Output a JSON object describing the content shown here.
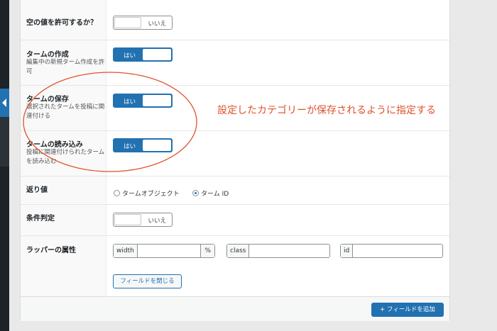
{
  "rows": {
    "allow_null": {
      "label": "空の値を許可するか？",
      "toggle": "いいえ"
    },
    "create_terms": {
      "label": "タームの作成",
      "desc": "編集中の新規ターム作成を許可",
      "toggle": "はい"
    },
    "save_terms": {
      "label": "タームの保存",
      "desc": "選択されたタームを投稿に関連付ける",
      "toggle": "はい"
    },
    "load_terms": {
      "label": "タームの読み込み",
      "desc": "投稿に関連付けられたタームを読み込む",
      "toggle": "はい"
    },
    "return_value": {
      "label": "返り値",
      "options": [
        "タームオブジェクト",
        "ターム ID"
      ],
      "selected": 1
    },
    "conditional": {
      "label": "条件判定",
      "toggle": "いいえ"
    },
    "wrapper": {
      "label": "ラッパーの属性",
      "width_label": "width",
      "width_suffix": "%",
      "class_label": "class",
      "id_label": "id"
    }
  },
  "close_button": "フィールドを閉じる",
  "add_button": "+ フィールドを追加",
  "annotation": "設定したカテゴリーが保存されるように指定する",
  "colors": {
    "accent": "#2271b1",
    "annotation": "#e0512c"
  }
}
